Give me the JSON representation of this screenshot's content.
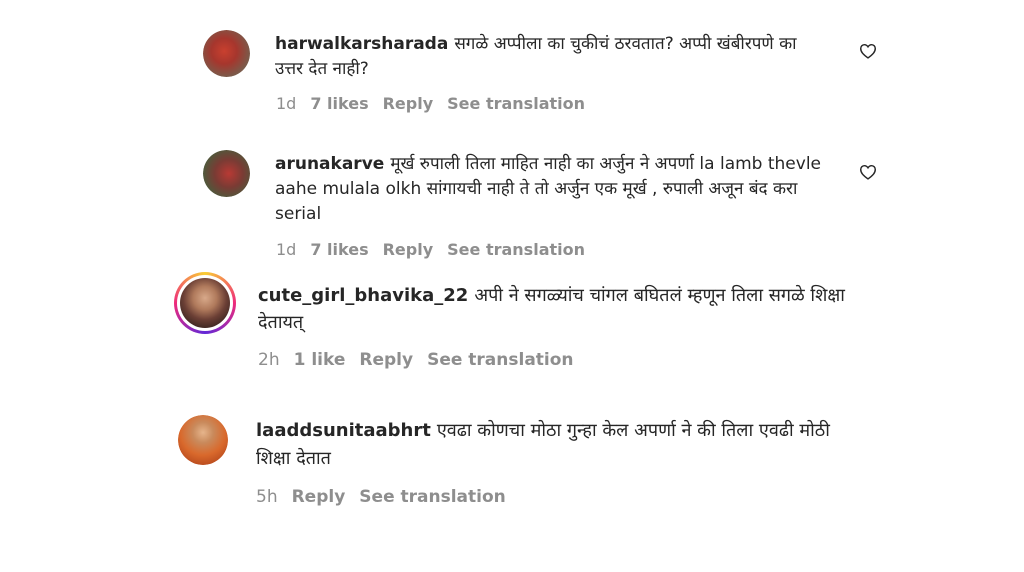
{
  "comments": [
    {
      "username": "harwalkarsharada",
      "text": "सगळे अप्पीला का चुकीचं ठरवतात? अप्पी खंबीरपणे का उत्तर देत नाही?",
      "time": "1d",
      "likes": "7 likes",
      "reply": "Reply",
      "translate": "See translation"
    },
    {
      "username": "arunakarve",
      "text": "मूर्ख रुपाली तिला माहित नाही का अर्जुन ने अपर्णा la lamb thevle aahe mulala olkh सांगायची नाही ते तो अर्जुन एक मूर्ख , रुपाली अजून बंद करा serial",
      "time": "1d",
      "likes": "7 likes",
      "reply": "Reply",
      "translate": "See translation"
    },
    {
      "username": "cute_girl_bhavika_22",
      "text": "अपी ने सगळ्यांच चांगल बघितलं म्हणून तिला सगळे शिक्षा देतायत्",
      "time": "2h",
      "likes": "1 like",
      "reply": "Reply",
      "translate": "See translation"
    },
    {
      "username": "laaddsunitaabhrt",
      "text": "एवढा कोणचा मोठा गुन्हा केल अपर्णा ने की तिला एवढी मोठी शिक्षा देतात",
      "time": "5h",
      "reply": "Reply",
      "translate": "See translation"
    }
  ],
  "colors": {
    "text": "#262626",
    "meta": "#8e8e8e"
  },
  "icons": {
    "like": "heart-outline-icon"
  }
}
